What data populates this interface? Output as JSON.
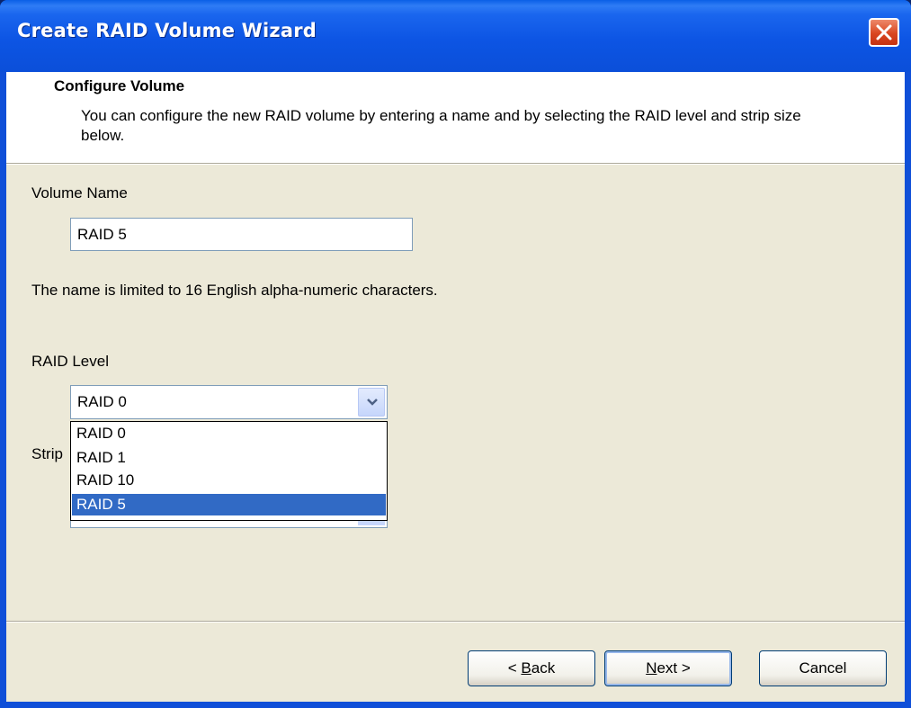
{
  "window": {
    "title": "Create RAID Volume Wizard",
    "close_icon": "close-icon"
  },
  "header": {
    "title": "Configure Volume",
    "description": "You can configure the new RAID volume by entering a name and by selecting the RAID level and strip size below."
  },
  "volume_name": {
    "label": "Volume Name",
    "value": "RAID 5",
    "hint": "The name is limited to 16 English alpha-numeric characters."
  },
  "raid_level": {
    "label": "RAID Level",
    "selected": "RAID 0",
    "options": [
      "RAID 0",
      "RAID 1",
      "RAID 10",
      "RAID 5"
    ],
    "highlighted_index": 3
  },
  "strip_size": {
    "label_visible_part": "Strip"
  },
  "buttons": {
    "back_prefix": "< ",
    "back_mnemonic": "B",
    "back_rest": "ack",
    "next_mnemonic": "N",
    "next_rest": "ext >",
    "cancel": "Cancel"
  },
  "colors": {
    "titlebar": "#0d55e4",
    "client_bg": "#ece9d8",
    "selection": "#316ac5"
  }
}
